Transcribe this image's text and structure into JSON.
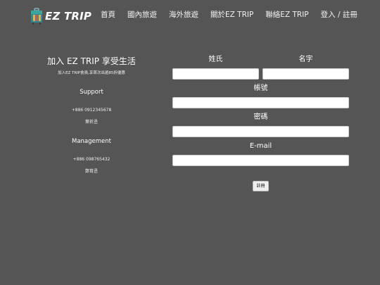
{
  "nav": {
    "logo_text": "EZ TRIP",
    "links": [
      "首頁",
      "國內旅遊",
      "海外旅遊",
      "關於EZ TRIP",
      "聯絡EZ TRIP",
      "登入 / 註冊"
    ]
  },
  "info": {
    "title": "加入 EZ TRIP 享受生活",
    "subtitle": "加入EZ TRIP會員,享首次出遊85折優惠",
    "support_heading": "Support",
    "support_phone": "+886 0912345678",
    "support_name": "葉祈丞",
    "management_heading": "Management",
    "management_phone": "+886 098765432",
    "management_name": "鄭育丞"
  },
  "form": {
    "last_name_label": "姓氏",
    "first_name_label": "名字",
    "account_label": "帳號",
    "password_label": "密碼",
    "email_label": "E-mail",
    "last_name_value": "",
    "first_name_value": "",
    "account_value": "",
    "password_value": "",
    "email_value": "",
    "submit_label": "註冊"
  }
}
